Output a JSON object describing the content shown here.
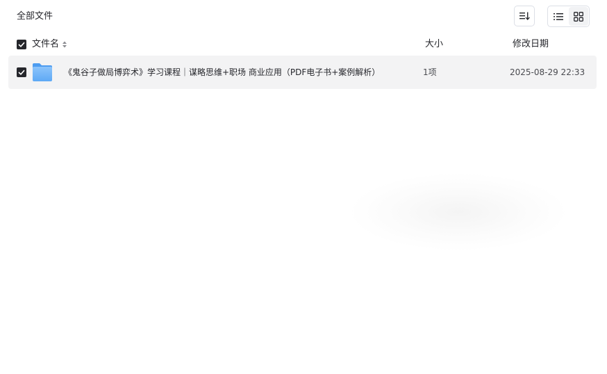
{
  "breadcrumb": {
    "label": "全部文件"
  },
  "toolbar": {
    "sort_icon": "sort-descending-icon",
    "view_list_icon": "list-view-icon",
    "view_grid_icon": "grid-view-icon",
    "active_view": "list"
  },
  "table": {
    "headers": {
      "name": "文件名",
      "size": "大小",
      "modified": "修改日期"
    },
    "select_all_checked": true,
    "rows": [
      {
        "checked": true,
        "icon": "folder-icon",
        "name": "《鬼谷子做局博弈术》学习课程｜谋略思维+职场 商业应用（PDF电子书+案例解析）",
        "size": "1项",
        "modified": "2025-08-29 22:33"
      }
    ]
  },
  "colors": {
    "text": "#25262b",
    "row_bg": "#f3f3f4",
    "checkbox": "#25262b",
    "folder": "#5ea9f5"
  }
}
